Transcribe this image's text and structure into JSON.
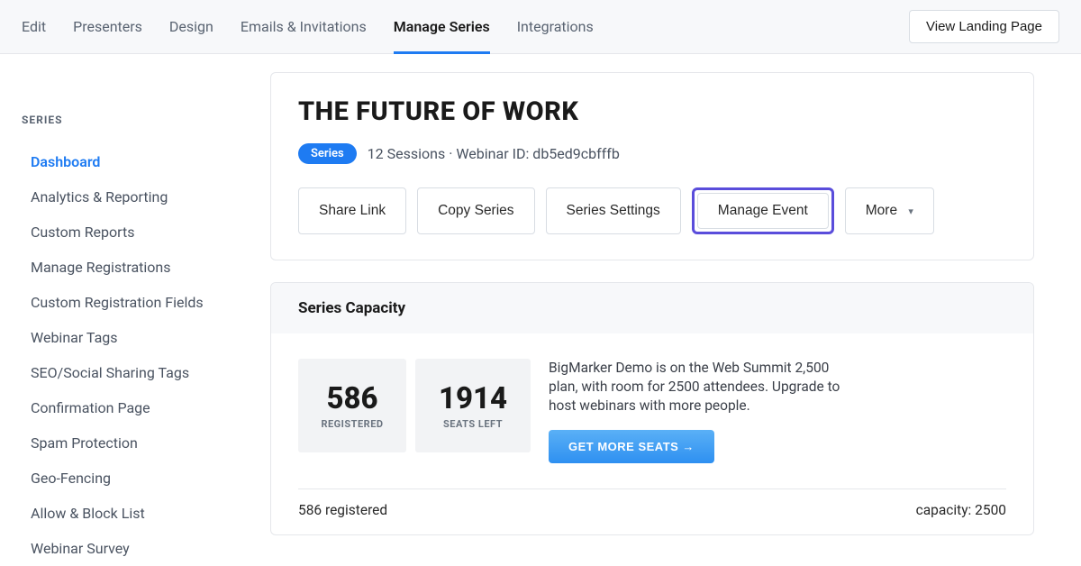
{
  "topnav": {
    "tabs": [
      {
        "label": "Edit"
      },
      {
        "label": "Presenters"
      },
      {
        "label": "Design"
      },
      {
        "label": "Emails & Invitations"
      },
      {
        "label": "Manage Series",
        "active": true
      },
      {
        "label": "Integrations"
      }
    ],
    "view_landing_label": "View Landing Page"
  },
  "sidebar": {
    "heading": "SERIES",
    "items": [
      {
        "label": "Dashboard",
        "active": true
      },
      {
        "label": "Analytics & Reporting"
      },
      {
        "label": "Custom Reports"
      },
      {
        "label": "Manage Registrations"
      },
      {
        "label": "Custom Registration Fields"
      },
      {
        "label": "Webinar Tags"
      },
      {
        "label": "SEO/Social Sharing Tags"
      },
      {
        "label": "Confirmation Page"
      },
      {
        "label": "Spam Protection"
      },
      {
        "label": "Geo-Fencing"
      },
      {
        "label": "Allow & Block List"
      },
      {
        "label": "Webinar Survey"
      }
    ]
  },
  "header": {
    "title": "THE FUTURE OF WORK",
    "pill": "Series",
    "meta": "12 Sessions · Webinar ID: db5ed9cbfffb",
    "actions": {
      "share_link": "Share Link",
      "copy_series": "Copy Series",
      "series_settings": "Series Settings",
      "manage_event": "Manage Event",
      "more": "More"
    }
  },
  "capacity": {
    "heading": "Series Capacity",
    "registered_num": "586",
    "registered_label": "REGISTERED",
    "seats_left_num": "1914",
    "seats_left_label": "SEATS LEFT",
    "description": "BigMarker Demo is on the Web Summit 2,500 plan, with room for 2500 attendees. Upgrade to host webinars with more people.",
    "get_seats_label": "GET MORE SEATS →",
    "footer_registered": "586 registered",
    "footer_capacity": "capacity: 2500"
  }
}
